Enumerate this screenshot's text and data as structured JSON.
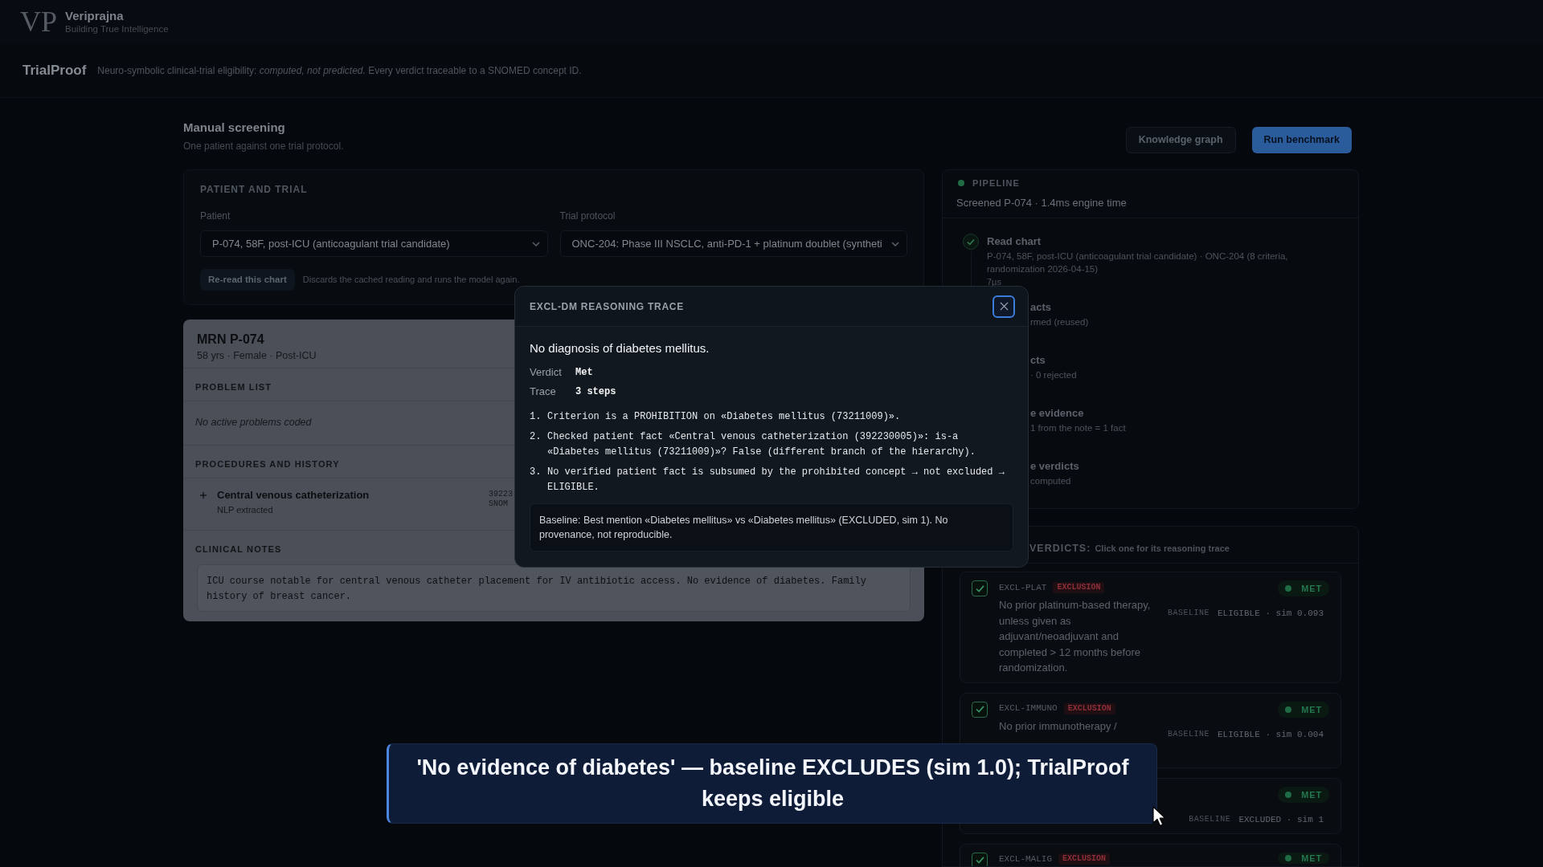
{
  "brand": {
    "mark": "VP",
    "name": "Veriprajna",
    "tagline": "Building True Intelligence"
  },
  "app": {
    "title": "TrialProof",
    "description": "Neuro-symbolic clinical-trial eligibility: *computed, not predicted.* Every verdict traceable to a SNOMED concept ID."
  },
  "screening": {
    "title": "Manual screening",
    "subtitle": "One patient against one trial protocol.",
    "actions": [
      {
        "label": "Knowledge graph",
        "kind": "secondary"
      },
      {
        "label": "Run benchmark",
        "kind": "primary"
      }
    ]
  },
  "patient_and_trial": {
    "heading": "PATIENT AND TRIAL",
    "selects": [
      {
        "label": "Patient",
        "value": "P-074, 58F, post-ICU (anticoagulant trial candidate)"
      },
      {
        "label": "Trial protocol",
        "value": "ONC-204: Phase III NSCLC, anti-PD-1 + platinum doublet (syntheti"
      }
    ],
    "reread": {
      "label": "Re-read this chart",
      "hint": "Discards the cached reading and runs the model again."
    }
  },
  "chart": {
    "title": "MRN P-074",
    "meta": "58 yrs · Female · Post-ICU",
    "sections": [
      {
        "kind": "empty",
        "heading": "PROBLEM LIST",
        "text": "No active problems coded"
      },
      {
        "kind": "procedures",
        "heading": "PROCEDURES AND HISTORY",
        "items": [
          {
            "name": "Central venous catheterization",
            "source": "NLP extracted",
            "code": "39223",
            "system": "SNOM"
          }
        ]
      },
      {
        "kind": "note",
        "heading": "CLINICAL NOTES",
        "text": "ICU course notable for central venous catheter placement for IV antibiotic access. No evidence of diabetes. Family history of breast cancer."
      }
    ]
  },
  "trace_dialog": {
    "title": "EXCL-DM REASONING TRACE",
    "criterion": "No diagnosis of diabetes mellitus.",
    "facts": [
      {
        "label": "Verdict",
        "value": "Met"
      },
      {
        "label": "Trace",
        "value": "3 steps"
      }
    ],
    "steps": [
      {
        "number": "1.",
        "text": "Criterion is a PROHIBITION on «Diabetes mellitus (73211009)»."
      },
      {
        "number": "2.",
        "text": "Checked patient fact «Central venous catheterization (392230005)»: is-a «Diabetes mellitus (73211009)»? False (different branch of the hierarchy)."
      },
      {
        "number": "3.",
        "text": "No verified patient fact is subsumed by the prohibited concept → not excluded → ELIGIBLE."
      }
    ],
    "baseline": "Baseline: Best mention «Diabetes mellitus» vs «Diabetes mellitus» (EXCLUDED, sim 1). No provenance, not reproducible."
  },
  "pipeline": {
    "heading": "PIPELINE",
    "summary": "Screened P-074 · 1.4ms engine time",
    "steps": [
      {
        "kind": "done",
        "title": "Read chart",
        "detail": "P-074, 58F, post-ICU (anticoagulant trial candidate) · ONC-204 (8 criteria, randomization 2026-04-15)",
        "timing": "7µs"
      },
      {
        "kind": "clipped",
        "title": "acts",
        "detail": "rmed (reused)"
      },
      {
        "kind": "clipped",
        "title": "cts",
        "detail": "· 0 rejected"
      },
      {
        "kind": "clipped",
        "title": "e evidence",
        "detail": "1 from the note = 1 fact"
      },
      {
        "kind": "clipped",
        "title": "e verdicts",
        "detail": "computed"
      }
    ]
  },
  "verdicts": {
    "heading": "VERDICTS:",
    "hint": "Click one for its reasoning trace",
    "items": [
      {
        "id": "EXCL-PLAT",
        "tag": "EXCLUSION",
        "checked": true,
        "text": "No prior platinum-based therapy, unless given as adjuvant/neoadjuvant and completed > 12 months before randomization.",
        "verdict": "MET",
        "met": true,
        "baseline_label": "BASELINE",
        "baseline": "ELIGIBLE · sim 0.093"
      },
      {
        "id": "EXCL-IMMUNO",
        "tag": "EXCLUSION",
        "checked": true,
        "text": "No prior immunotherapy /",
        "verdict": "MET",
        "met": true,
        "baseline_label": "BASELINE",
        "baseline": "ELIGIBLE · sim 0.004"
      },
      {
        "verdict": "MET",
        "met": true,
        "baseline_label": "BASELINE",
        "baseline": "EXCLUDED · sim 1"
      },
      {
        "id": "EXCL-MALIG",
        "tag": "EXCLUSION",
        "checked": true,
        "verdict": "MET",
        "met": true
      }
    ]
  },
  "caption": "'No evidence of diabetes' — baseline EXCLUDES (sim 1.0); TrialProof keeps eligible"
}
